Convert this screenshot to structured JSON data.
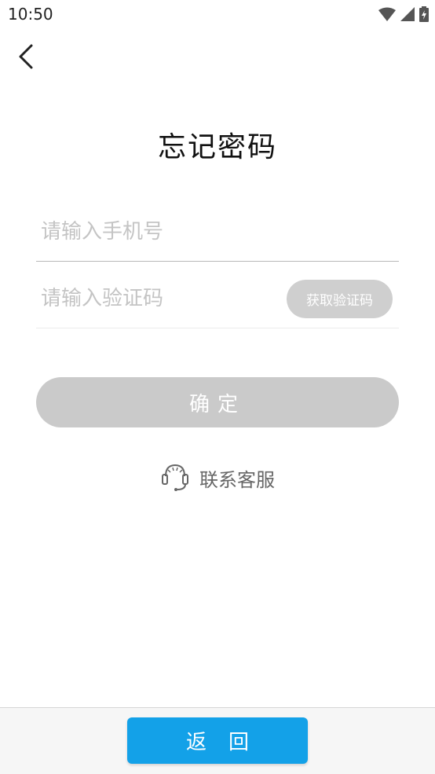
{
  "status_bar": {
    "time": "10:50"
  },
  "header": {
    "title": "忘记密码"
  },
  "form": {
    "phone_placeholder": "请输入手机号",
    "code_placeholder": "请输入验证码",
    "get_code_label": "获取验证码",
    "confirm_label": "确定"
  },
  "support": {
    "label": "联系客服"
  },
  "footer": {
    "return_label": "返回"
  },
  "colors": {
    "primary": "#13a1e8",
    "disabled": "#cacaca"
  },
  "icons": [
    "back-arrow-icon",
    "wifi-icon",
    "signal-icon",
    "battery-icon",
    "headset-icon"
  ]
}
